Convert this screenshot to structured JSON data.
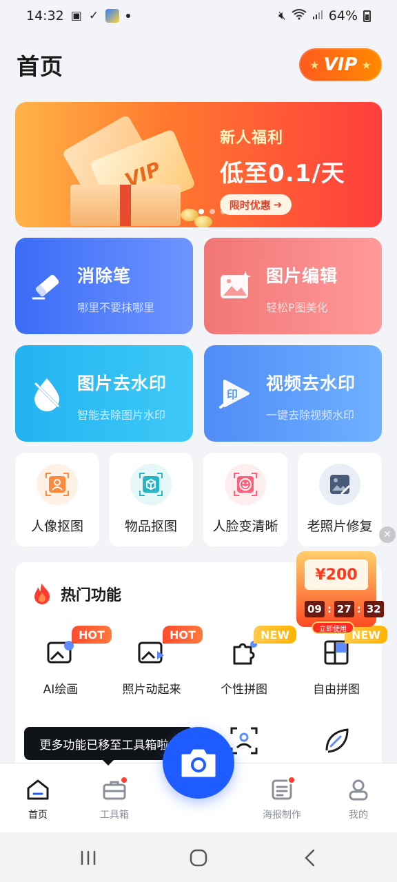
{
  "status_bar": {
    "time": "14:32",
    "battery": "64%"
  },
  "header": {
    "title": "首页",
    "vip_label": "VIP"
  },
  "banner": {
    "subtitle": "新人福利",
    "headline": "低至0.1/天",
    "cta": "限时优惠",
    "ticket_text": "VIP",
    "carousel_dots": 4,
    "active_dot": 1
  },
  "feature_cards": [
    {
      "title": "消除笔",
      "subtitle": "哪里不要抹哪里",
      "icon": "eraser-pen-icon"
    },
    {
      "title": "图片编辑",
      "subtitle": "轻松P图美化",
      "icon": "image-sparkle-icon"
    },
    {
      "title": "图片去水印",
      "subtitle": "智能去除图片水印",
      "icon": "drop-slash-icon"
    },
    {
      "title": "视频去水印",
      "subtitle": "一键去除视频水印",
      "icon": "video-stamp-icon",
      "icon_text": "印"
    }
  ],
  "tools": [
    {
      "label": "人像抠图",
      "icon": "portrait-cutout-icon"
    },
    {
      "label": "物品抠图",
      "icon": "object-cutout-icon"
    },
    {
      "label": "人脸变清晰",
      "icon": "face-enhance-icon"
    },
    {
      "label": "老照片修复",
      "icon": "photo-repair-icon"
    }
  ],
  "hot": {
    "title": "热门功能",
    "items": [
      {
        "label": "AI绘画",
        "tag": "HOT",
        "icon": "ai-paint-icon"
      },
      {
        "label": "照片动起来",
        "tag": "HOT",
        "icon": "photo-animate-icon"
      },
      {
        "label": "个性拼图",
        "tag": "NEW",
        "icon": "puzzle-icon"
      },
      {
        "label": "自由拼图",
        "tag": "NEW",
        "icon": "collage-icon"
      }
    ],
    "partial_icons": [
      "face-scan-icon",
      "leaf-slash-icon"
    ]
  },
  "coupon": {
    "amount": "¥200",
    "timer": [
      "09",
      "27",
      "32"
    ],
    "cta": "立即使用"
  },
  "tooltip": "更多功能已移至工具箱啦~",
  "bottom_nav": [
    {
      "label": "首页",
      "icon": "home-icon",
      "active": true
    },
    {
      "label": "工具箱",
      "icon": "toolbox-icon",
      "badge": true
    },
    {
      "label": "海报制作",
      "icon": "poster-icon",
      "badge": true
    },
    {
      "label": "我的",
      "icon": "profile-icon"
    }
  ],
  "colors": {
    "accent": "#1f5cff",
    "vip": "#ff6a1a",
    "hot": "#ff4a2e",
    "new": "#ffbf2a"
  }
}
